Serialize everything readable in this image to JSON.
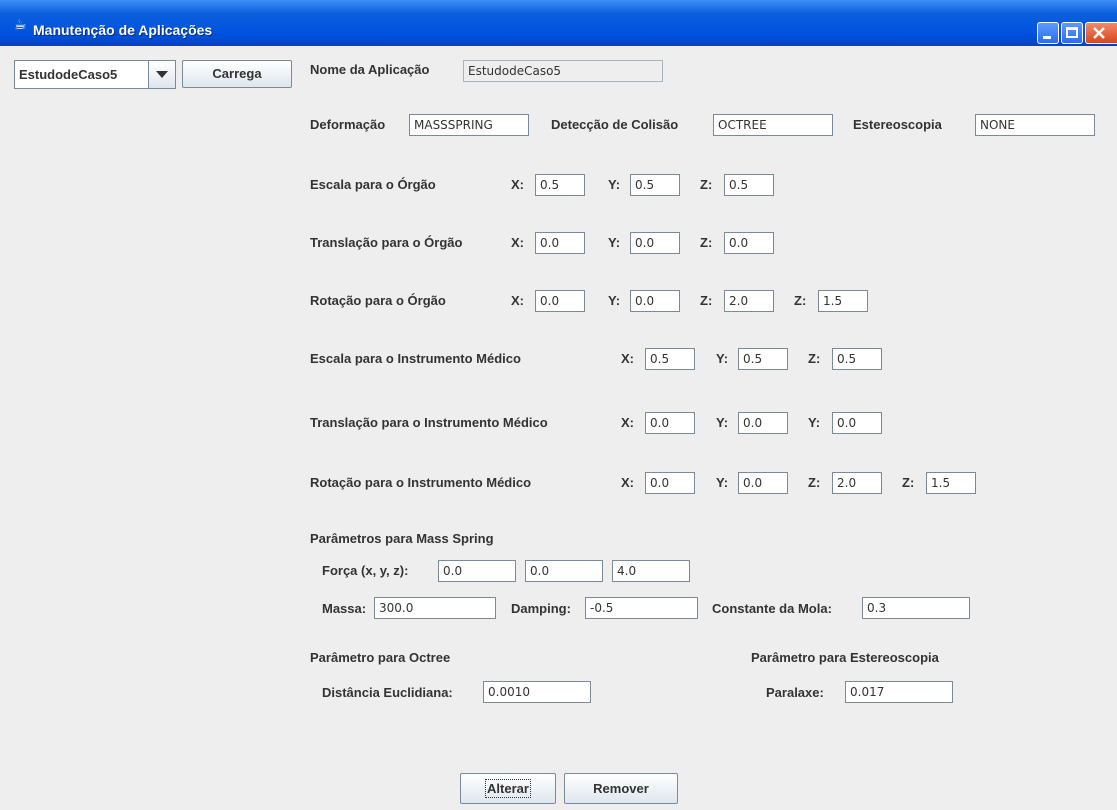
{
  "window": {
    "title": "Manutenção de Aplicações",
    "icon": "java-coffee-icon"
  },
  "sidebar": {
    "combo_value": "EstudodeCaso5",
    "load_button": "Carrega"
  },
  "app_name": {
    "label": "Nome da Aplicação",
    "value": "EstudodeCaso5"
  },
  "deformation": {
    "label": "Deformação",
    "value": "MASSSPRING"
  },
  "collision": {
    "label": "Detecção de Colisão",
    "value": "OCTREE"
  },
  "stereo": {
    "label": "Estereoscopia",
    "value": "NONE"
  },
  "organ_scale": {
    "label": "Escala para o Órgão",
    "x_label": "X:",
    "x": "0.5",
    "y_label": "Y:",
    "y": "0.5",
    "z_label": "Z:",
    "z": "0.5"
  },
  "organ_translation": {
    "label": "Translação para o Órgão",
    "x_label": "X:",
    "x": "0.0",
    "y_label": "Y:",
    "y": "0.0",
    "z_label": "Z:",
    "z": "0.0"
  },
  "organ_rotation": {
    "label": "Rotação para o Órgão",
    "x_label": "X:",
    "x": "0.0",
    "y_label": "Y:",
    "y": "0.0",
    "z_label": "Z:",
    "z": "2.0",
    "z2_label": "Z:",
    "z2": "1.5"
  },
  "instr_scale": {
    "label": "Escala para o Instrumento Médico",
    "x_label": "X:",
    "x": "0.5",
    "y_label": "Y:",
    "y": "0.5",
    "z_label": "Z:",
    "z": "0.5"
  },
  "instr_translation": {
    "label": "Translação para o Instrumento Médico",
    "x_label": "X:",
    "x": "0.0",
    "y_label": "Y:",
    "y": "0.0",
    "y2_label": "Y:",
    "y2": "0.0"
  },
  "instr_rotation": {
    "label": "Rotação para o Instrumento Médico",
    "x_label": "X:",
    "x": "0.0",
    "y_label": "Y:",
    "y": "0.0",
    "z_label": "Z:",
    "z": "2.0",
    "z2_label": "Z:",
    "z2": "1.5"
  },
  "mass_spring": {
    "title": "Parâmetros para Mass Spring",
    "force_label": "Força (x, y, z):",
    "force_x": "0.0",
    "force_y": "0.0",
    "force_z": "4.0",
    "mass_label": "Massa:",
    "mass": "300.0",
    "damping_label": "Damping:",
    "damping": "-0.5",
    "spring_label": "Constante da Mola:",
    "spring": "0.3"
  },
  "octree": {
    "title": "Parâmetro para Octree",
    "dist_label": "Distância Euclidiana:",
    "dist": "0.0010"
  },
  "stereoscopy": {
    "title": "Parâmetro para Estereoscopia",
    "parallax_label": "Paralaxe:",
    "parallax": "0.017"
  },
  "actions": {
    "alter": "Alterar",
    "remove": "Remover"
  }
}
